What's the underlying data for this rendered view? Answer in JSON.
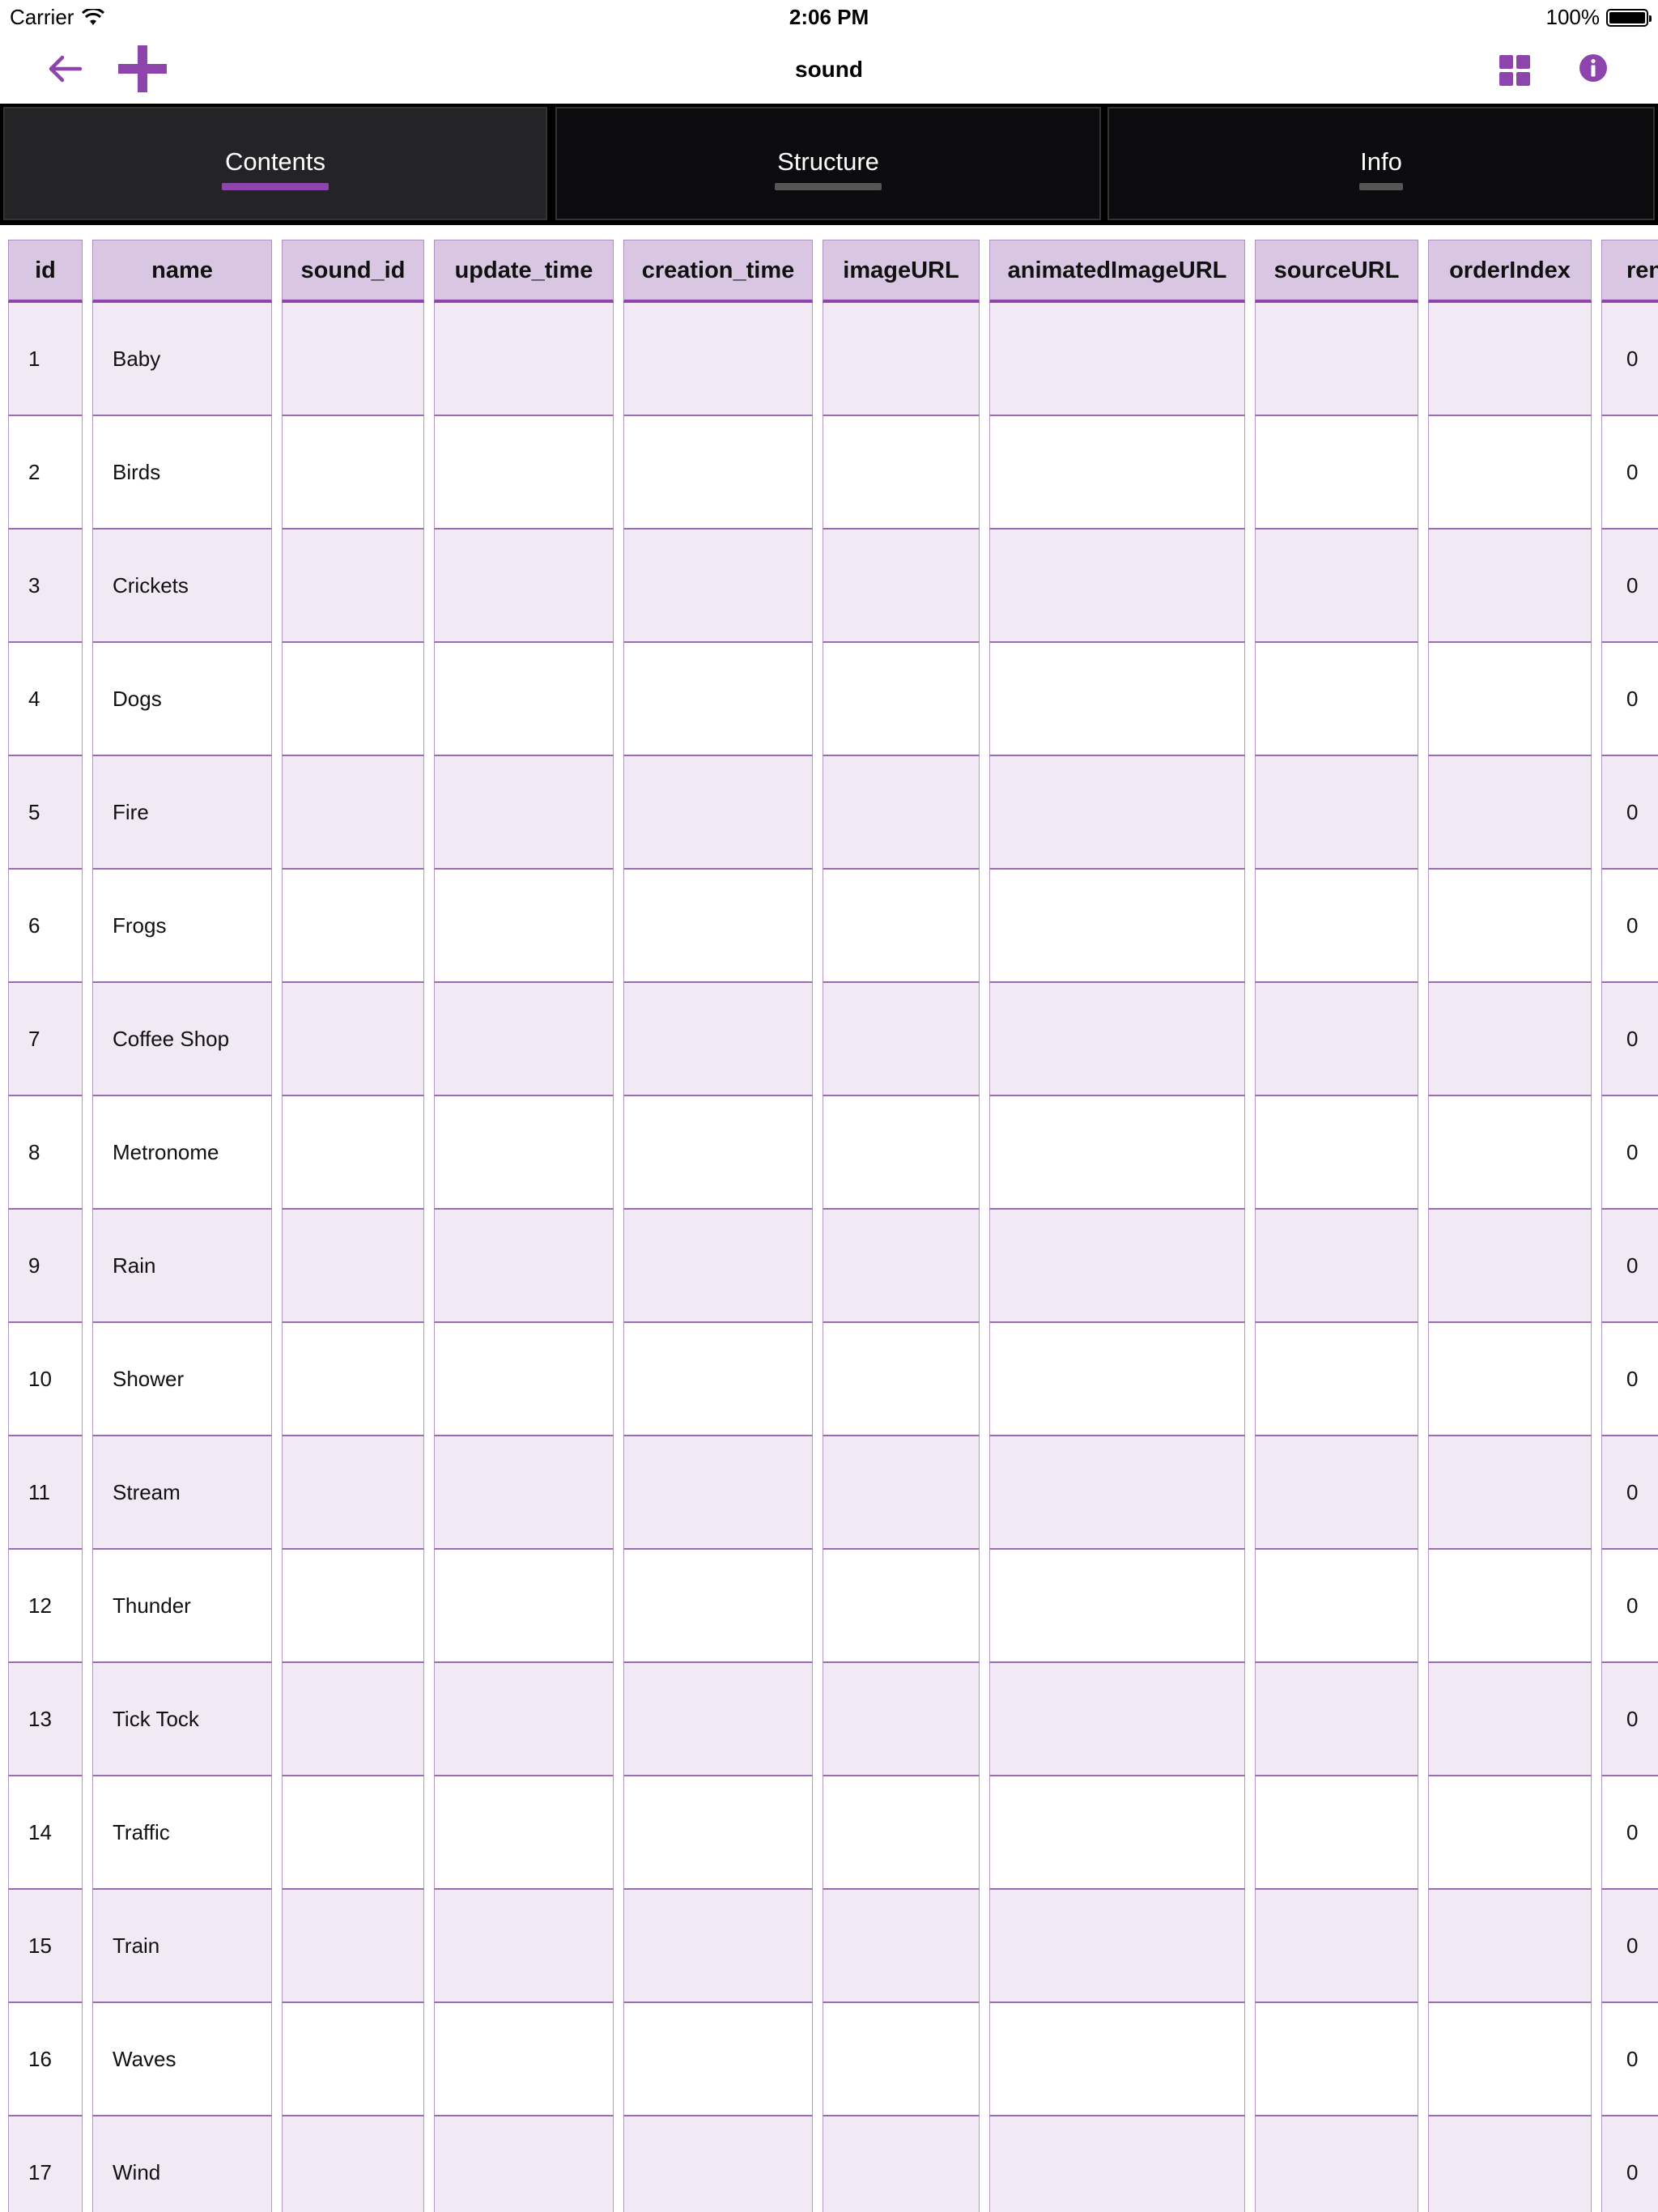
{
  "status_bar": {
    "carrier": "Carrier",
    "time": "2:06 PM",
    "battery": "100%"
  },
  "nav": {
    "title": "sound",
    "icons": [
      "back-arrow-icon",
      "plus-icon",
      "grid-view-icon",
      "info-icon"
    ],
    "accent_color": "#8e44ad"
  },
  "tabs": [
    {
      "label": "Contents",
      "active": true
    },
    {
      "label": "Structure",
      "active": false
    },
    {
      "label": "Info",
      "active": false
    }
  ],
  "table": {
    "columns": [
      "id",
      "name",
      "sound_id",
      "update_time",
      "creation_time",
      "imageURL",
      "animatedImageURL",
      "sourceURL",
      "orderIndex",
      "ren"
    ],
    "rows": [
      {
        "id": "1",
        "name": "Baby",
        "ren": "0"
      },
      {
        "id": "2",
        "name": "Birds",
        "ren": "0"
      },
      {
        "id": "3",
        "name": "Crickets",
        "ren": "0"
      },
      {
        "id": "4",
        "name": "Dogs",
        "ren": "0"
      },
      {
        "id": "5",
        "name": "Fire",
        "ren": "0"
      },
      {
        "id": "6",
        "name": "Frogs",
        "ren": "0"
      },
      {
        "id": "7",
        "name": "Coffee Shop",
        "ren": "0"
      },
      {
        "id": "8",
        "name": "Metronome",
        "ren": "0"
      },
      {
        "id": "9",
        "name": "Rain",
        "ren": "0"
      },
      {
        "id": "10",
        "name": "Shower",
        "ren": "0"
      },
      {
        "id": "11",
        "name": "Stream",
        "ren": "0"
      },
      {
        "id": "12",
        "name": "Thunder",
        "ren": "0"
      },
      {
        "id": "13",
        "name": "Tick Tock",
        "ren": "0"
      },
      {
        "id": "14",
        "name": "Traffic",
        "ren": "0"
      },
      {
        "id": "15",
        "name": "Train",
        "ren": "0"
      },
      {
        "id": "16",
        "name": "Waves",
        "ren": "0"
      },
      {
        "id": "17",
        "name": "Wind",
        "ren": "0"
      }
    ]
  }
}
